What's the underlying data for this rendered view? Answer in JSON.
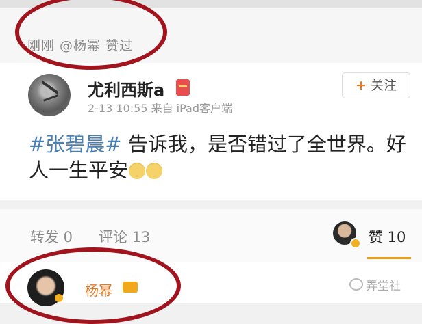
{
  "liked_bar": {
    "text": "刚刚 @杨幂 赞过"
  },
  "post": {
    "username": "尤利西斯a",
    "meta": "2-13 10:55  来自 iPad客户端",
    "follow_plus": "+",
    "follow_label": "关注",
    "hashtag": "#张碧晨#",
    "body": " 告诉我，是否错过了全世界。好人一生平安"
  },
  "actions": {
    "repost": "转发 0",
    "comment": "评论 13",
    "like": "赞 10"
  },
  "comment": {
    "name": "杨幂"
  },
  "watermark": {
    "text": "弄堂社"
  },
  "colors": {
    "highlight_circle": "#a1141e",
    "accent": "#f39c12",
    "hashtag": "#4a7fb0"
  }
}
